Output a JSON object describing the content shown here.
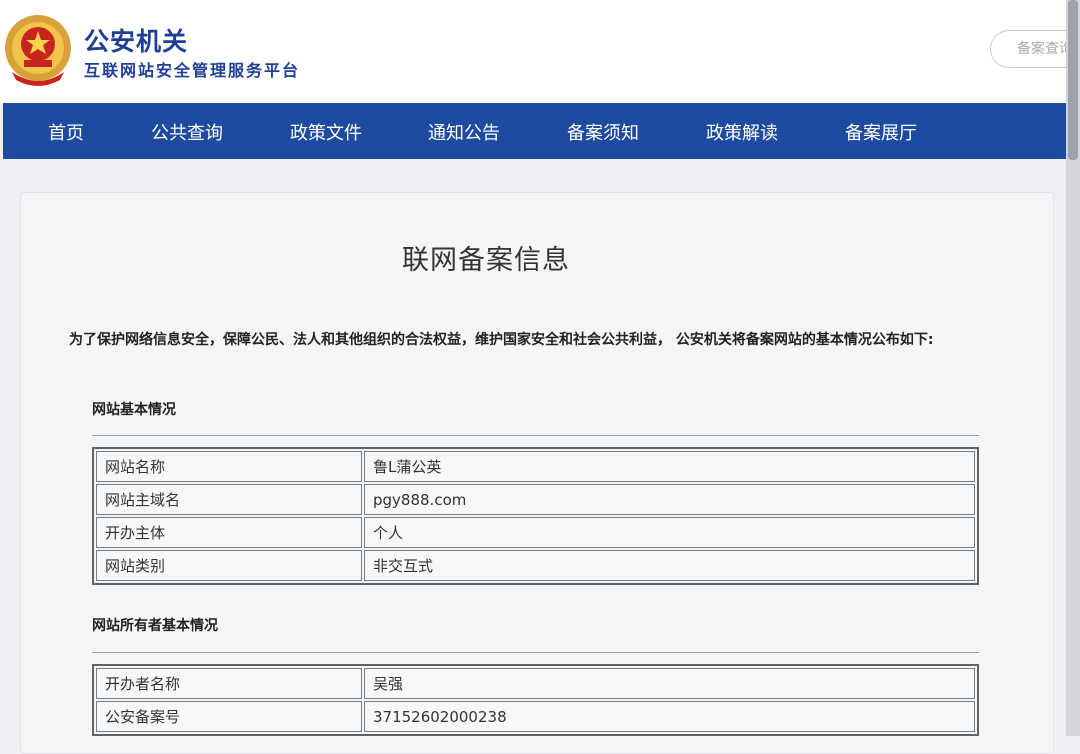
{
  "header": {
    "site_name": "公安机关",
    "site_subtitle": "互联网站安全管理服务平台",
    "search_placeholder": "备案查询"
  },
  "nav": [
    {
      "label": "首页"
    },
    {
      "label": "公共查询"
    },
    {
      "label": "政策文件"
    },
    {
      "label": "通知公告"
    },
    {
      "label": "备案须知"
    },
    {
      "label": "政策解读"
    },
    {
      "label": "备案展厅"
    }
  ],
  "colors": {
    "nav_bg": "#1e4ba0",
    "brand_text": "#1f3f97"
  },
  "main": {
    "title": "联网备案信息",
    "intro": "为了保护网络信息安全，保障公民、法人和其他组织的合法权益，维护国家安全和社会公共利益， 公安机关将备案网站的基本情况公布如下:",
    "section1": {
      "title": "网站基本情况",
      "rows": [
        {
          "label": "网站名称",
          "value": "鲁L蒲公英"
        },
        {
          "label": "网站主域名",
          "value": "pgy888.com"
        },
        {
          "label": "开办主体",
          "value": "个人"
        },
        {
          "label": "网站类别",
          "value": "非交互式"
        }
      ]
    },
    "section2": {
      "title": "网站所有者基本情况",
      "rows": [
        {
          "label": "开办者名称",
          "value": "吴强"
        },
        {
          "label": "公安备案号",
          "value": "37152602000238"
        }
      ]
    }
  }
}
